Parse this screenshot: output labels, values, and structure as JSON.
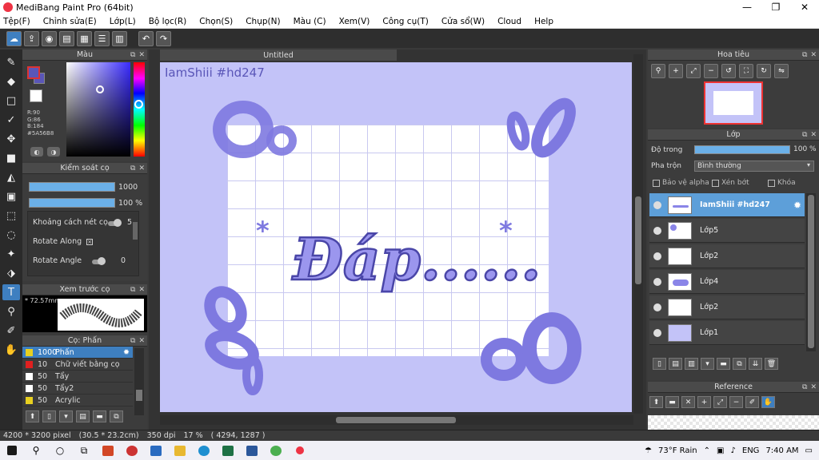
{
  "window": {
    "title": "MediBang Paint Pro (64bit)",
    "minimize": "—",
    "maximize": "❐",
    "close": "✕"
  },
  "menu": [
    "Tệp(F)",
    "Chỉnh sửa(E)",
    "Lớp(L)",
    "Bộ lọc(R)",
    "Chọn(S)",
    "Chụp(N)",
    "Màu (C)",
    "Xem(V)",
    "Công cụ(T)",
    "Cửa sổ(W)",
    "Cloud",
    "Help"
  ],
  "color_panel": {
    "title": "Màu",
    "r": "R:90",
    "g": "G:86",
    "b": "B:184",
    "hex": "#5A56B8",
    "fg_color": "#5a56b8"
  },
  "brush_control": {
    "title": "Kiểm soát cọ",
    "size_value": "1000",
    "opacity_value": "100 %",
    "spacing_label": "Khoảng cách nét cọ",
    "spacing_value": "5",
    "rotate_along_label": "Rotate Along",
    "rotate_angle_label": "Rotate Angle",
    "rotate_angle_value": "0"
  },
  "brush_preview": {
    "title": "Xem trước cọ",
    "size": "* 72.57mm"
  },
  "brush_list": {
    "title": "Cọ: Phấn",
    "items": [
      {
        "size": "1000",
        "name": "Phấn",
        "color": "#e8d020"
      },
      {
        "size": "10",
        "name": "Chữ viết bằng cọ",
        "color": "#e02020"
      },
      {
        "size": "50",
        "name": "Tẩy",
        "color": "#ffffff"
      },
      {
        "size": "50",
        "name": "Tẩy2",
        "color": "#ffffff"
      },
      {
        "size": "50",
        "name": "Acrylic",
        "color": "#e8d020"
      }
    ]
  },
  "document": {
    "tab": "Untitled",
    "watermark": "IamShiii #hd247",
    "art_text": "Đáp......",
    "bg_color": "#c3c3f8",
    "accent": "#8a85e8"
  },
  "navigator": {
    "title": "Hoa tiêu"
  },
  "layers": {
    "title": "Lớp",
    "opacity_label": "Độ trong",
    "opacity_value": "100 %",
    "blend_label": "Pha trộn",
    "blend_value": "Bình thường",
    "protect_alpha": "Bảo vệ alpha",
    "clipping": "Xén bớt",
    "lock": "Khóa",
    "items": [
      {
        "name": "IamShiii #hd247",
        "selected": true
      },
      {
        "name": "Lớp5",
        "selected": false
      },
      {
        "name": "Lớp2",
        "selected": false
      },
      {
        "name": "Lớp4",
        "selected": false
      },
      {
        "name": "Lớp2",
        "selected": false
      },
      {
        "name": "Lớp1",
        "selected": false
      }
    ]
  },
  "reference": {
    "title": "Reference"
  },
  "status": {
    "dimensions": "4200 * 3200 pixel",
    "physical": "(30.5 * 23.2cm)",
    "dpi": "350 dpi",
    "zoom": "17 %",
    "coords": "( 4294, 1287 )"
  },
  "taskbar": {
    "weather": "73°F  Rain",
    "lang": "ENG",
    "time": "7:40 AM"
  }
}
